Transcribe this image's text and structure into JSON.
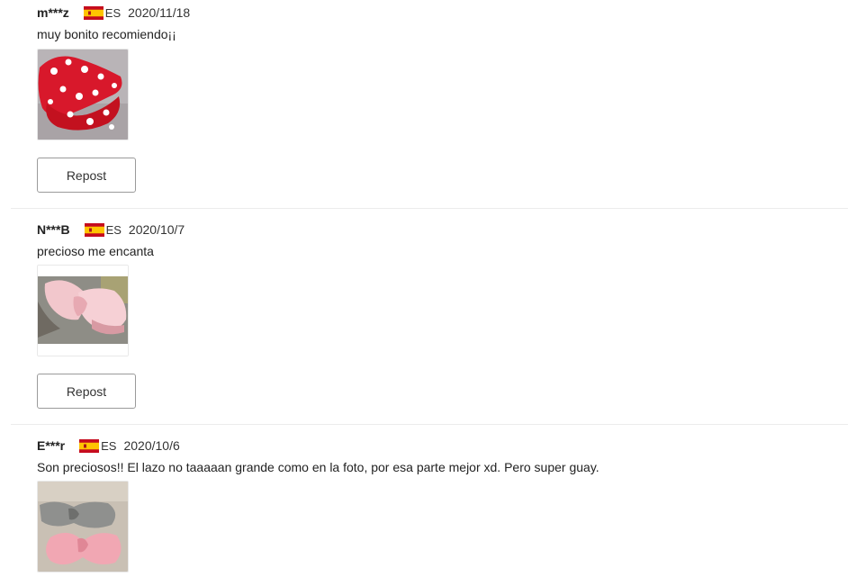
{
  "reviews": [
    {
      "user": "m***z",
      "country": "ES",
      "flag_icon": "spain-flag-icon",
      "date": "2020/11/18",
      "text": "muy bonito recomiendo¡¡",
      "photo_icon": "red-polka-dot-headband-photo",
      "repost_label": "Repost"
    },
    {
      "user": "N***B",
      "country": "ES",
      "flag_icon": "spain-flag-icon",
      "date": "2020/10/7",
      "text": "precioso me encanta",
      "photo_icon": "pink-bow-headband-photo",
      "repost_label": "Repost"
    },
    {
      "user": "E***r",
      "country": "ES",
      "flag_icon": "spain-flag-icon",
      "date": "2020/10/6",
      "text": "Son preciosos!! El lazo no taaaaan grande como en la foto, por esa parte mejor xd. Pero super guay.",
      "photo_icon": "grey-and-pink-bow-headbands-photo"
    }
  ],
  "colors": {
    "flag_red": "#c60b1e",
    "flag_yellow": "#ffc400",
    "divider": "#ececec",
    "button_border": "#9a9a9a"
  }
}
